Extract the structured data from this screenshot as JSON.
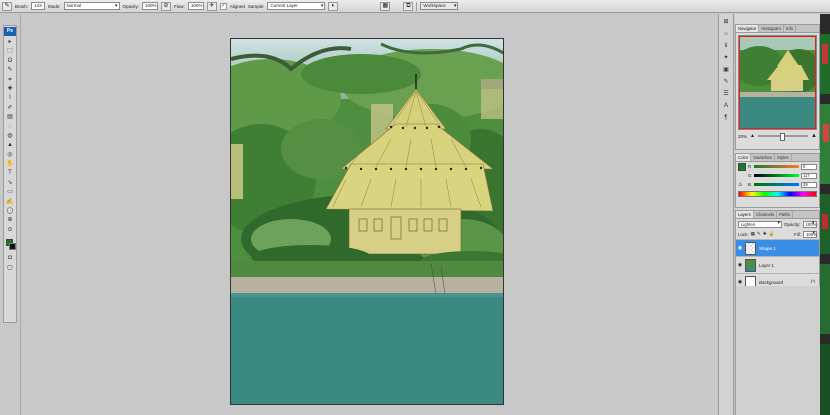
{
  "options_bar": {
    "brush_label": "Brush:",
    "brush_size": "143",
    "mode_label": "Mode:",
    "mode_value": "Normal",
    "opacity_label": "Opacity:",
    "opacity_value": "100%",
    "flow_label": "Flow:",
    "flow_value": "100%",
    "aligned_label": "Aligned",
    "sample_label": "Sample:",
    "sample_value": "Current Layer",
    "workspace_label": "Workspace"
  },
  "toolbox": {
    "logo": "Ps",
    "tools": [
      "▸",
      "⬚",
      "ʘ",
      "✎",
      "⌗",
      "✚",
      "⌇",
      "✐",
      "▤",
      "◌",
      "◍",
      "▲",
      "◎",
      "✋",
      "T",
      "➘",
      "▭",
      "✍",
      "◯",
      "⊕",
      "⊙"
    ],
    "foreground_color": "#187a2a",
    "background_color": "#111111"
  },
  "dock_icons": [
    "⊞",
    "⌂",
    "ℹ",
    "✦",
    "▣",
    "✎",
    "☰",
    "Ａ",
    "¶"
  ],
  "navigator": {
    "tabs": [
      "Navigator",
      "Histogram",
      "Info"
    ],
    "zoom": "20%"
  },
  "color_panel": {
    "tabs": [
      "Color",
      "Swatches",
      "Styles"
    ],
    "channels": [
      {
        "letter": "R",
        "value": "0"
      },
      {
        "letter": "G",
        "value": "117"
      },
      {
        "letter": "B",
        "value": "29"
      }
    ]
  },
  "layers_panel": {
    "tabs": [
      "Layers",
      "Channels",
      "Paths"
    ],
    "blend_mode": "Lighten",
    "opacity_label": "Opacity:",
    "opacity_value": "100%",
    "lock_label": "Lock:",
    "fill_label": "Fill:",
    "fill_value": "100%",
    "layers": [
      {
        "name": "Shape 1",
        "active": true
      },
      {
        "name": "Layer 1",
        "active": false
      },
      {
        "name": "Background",
        "active": false
      }
    ]
  },
  "colors": {
    "selection": "#3a8ee6",
    "water": "#3a8a82",
    "foliage": "#3f7f34",
    "roof": "#d6d07a"
  }
}
